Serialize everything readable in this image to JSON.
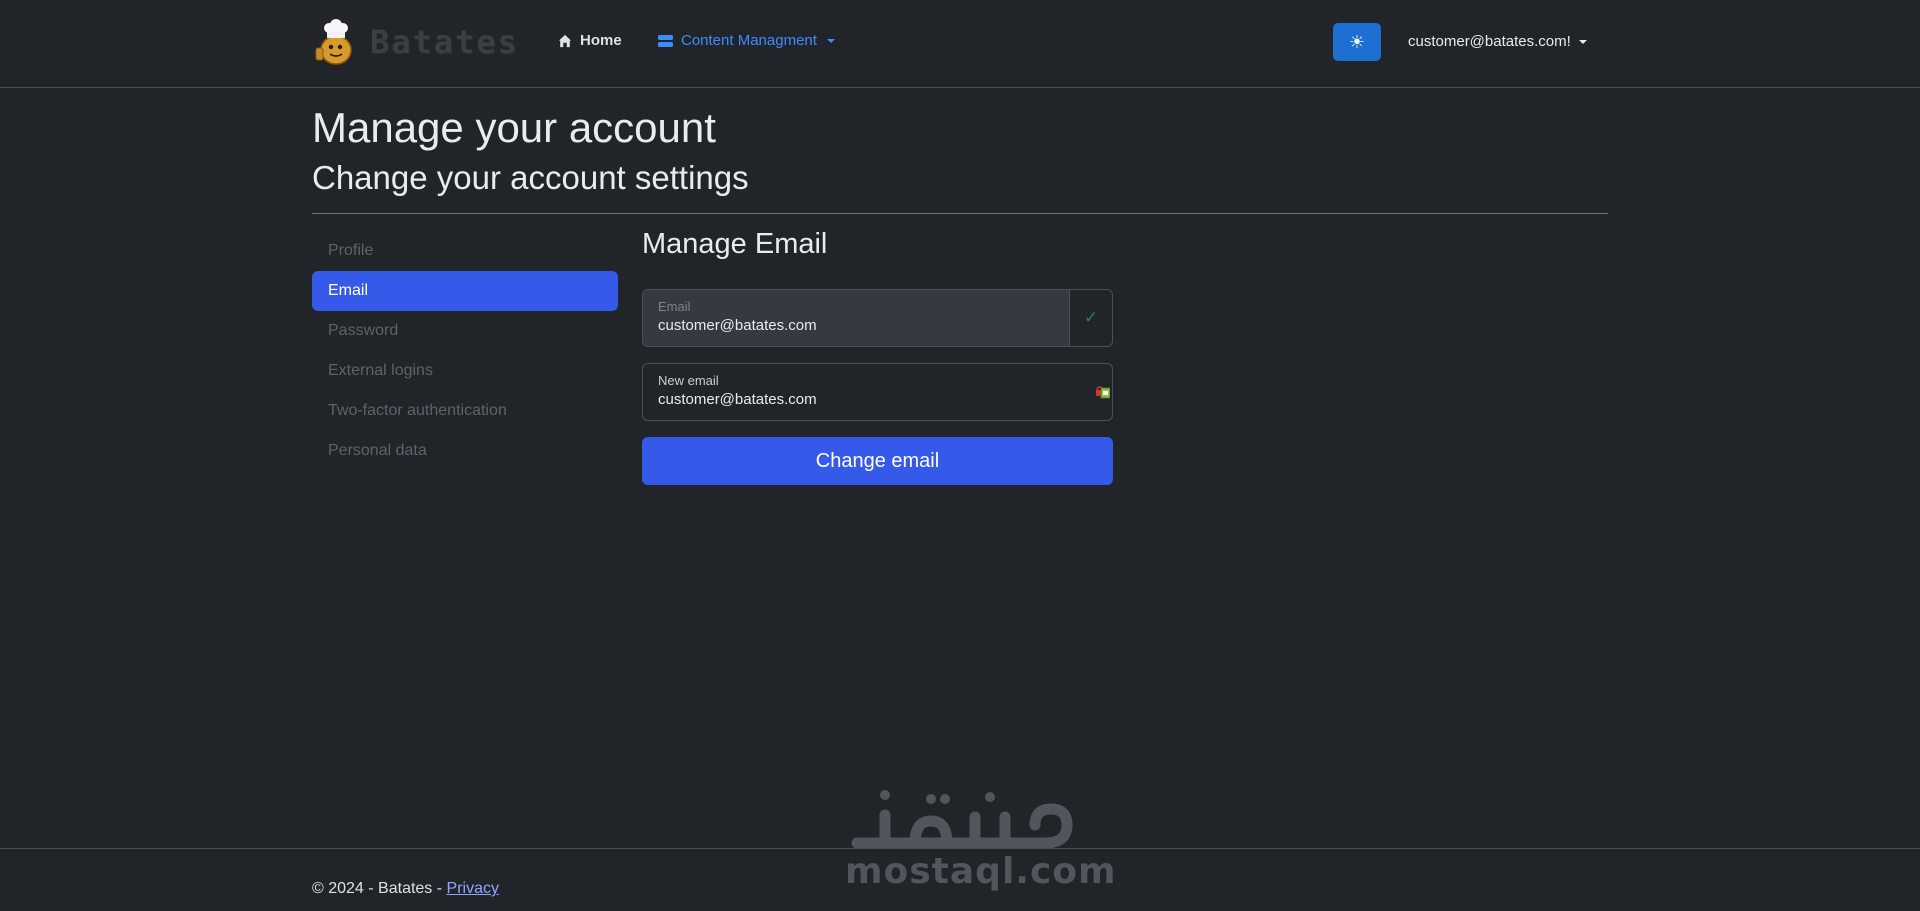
{
  "brand": {
    "name": "Batates",
    "logo_icon": "potato-chef-icon"
  },
  "nav": {
    "home_label": "Home",
    "home_icon": "house-icon",
    "content_label": "Content Managment",
    "content_icon": "layers-icon"
  },
  "header": {
    "theme_toggle_icon": "sun-icon",
    "theme_toggle_glyph": "☀",
    "user_menu_label": "customer@batates.com!"
  },
  "page": {
    "title": "Manage your account",
    "subtitle": "Change your account settings"
  },
  "sidebar": {
    "items": [
      {
        "label": "Profile",
        "active": false
      },
      {
        "label": "Email",
        "active": true
      },
      {
        "label": "Password",
        "active": false
      },
      {
        "label": "External logins",
        "active": false
      },
      {
        "label": "Two-factor authentication",
        "active": false
      },
      {
        "label": "Personal data",
        "active": false
      }
    ]
  },
  "main": {
    "section_title": "Manage Email",
    "email_field": {
      "label": "Email",
      "value": "customer@batates.com",
      "verified_glyph": "✓"
    },
    "new_email_field": {
      "label": "New email",
      "value": "customer@batates.com"
    },
    "submit_label": "Change email"
  },
  "footer": {
    "text": "© 2024 - Batates - ",
    "privacy_label": "Privacy"
  },
  "watermark": {
    "arabic": "مستقل",
    "latin": "mostaql.com"
  },
  "colors": {
    "background": "#212529",
    "accent": "#3559e8",
    "theme_button": "#1d6fd1",
    "link": "#3d8bfd",
    "success": "#198754"
  }
}
